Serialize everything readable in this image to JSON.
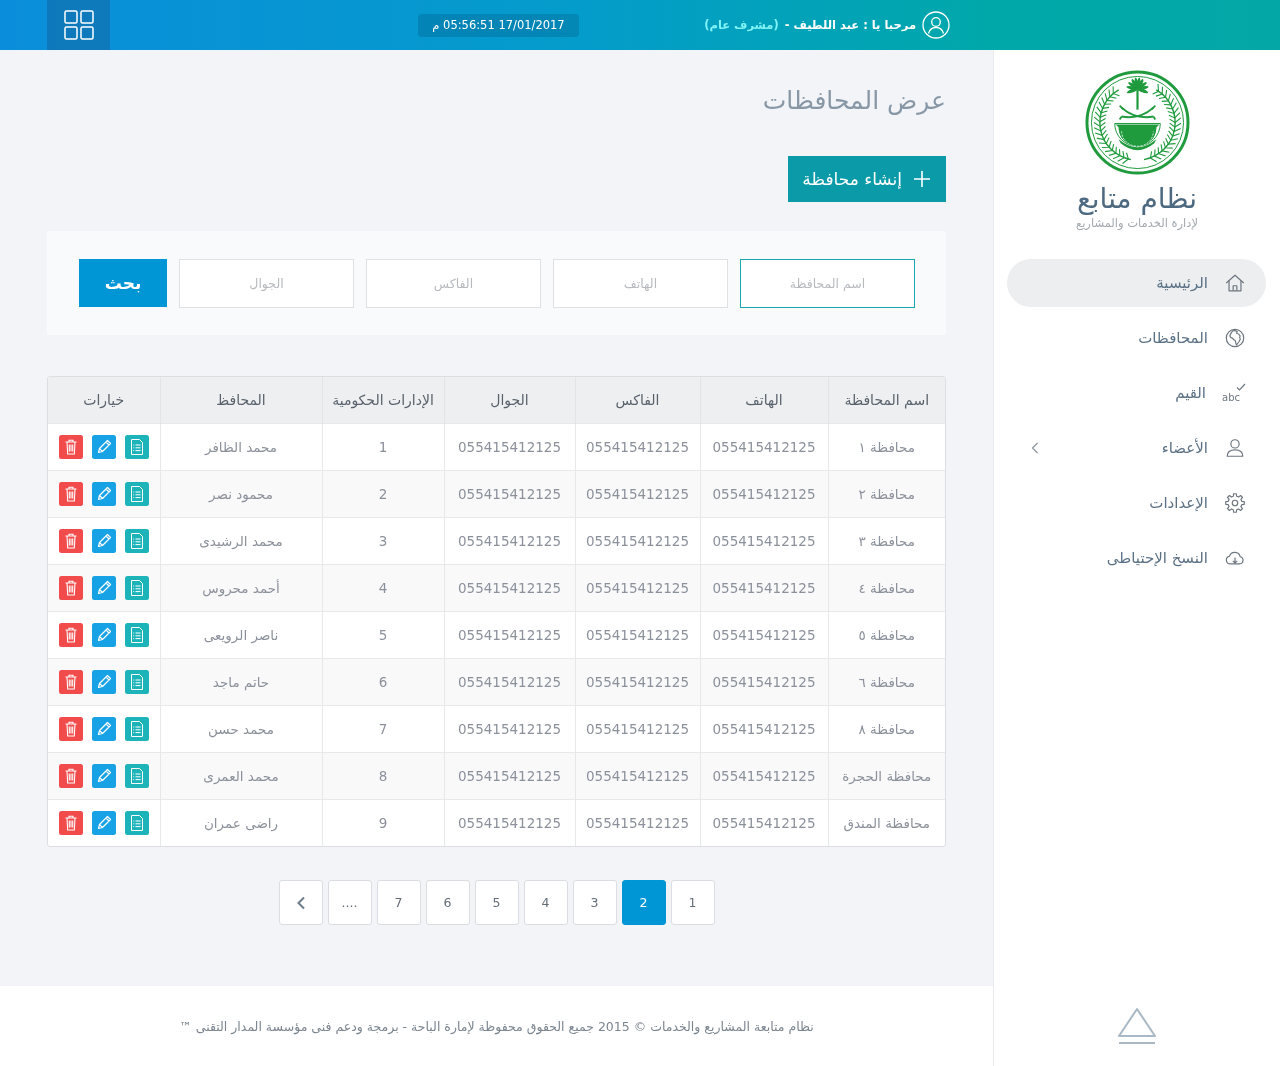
{
  "header": {
    "greeting": "مرحبا يا : عبد اللطيف -",
    "role": "(مشرف عام)",
    "datetime": "17/01/2017 05:56:51 م"
  },
  "sidebar": {
    "title": "نظام متابع",
    "subtitle": "لإدارة الخدمات والمشاريع",
    "items": [
      {
        "label": "الرئيسية",
        "kind": "link",
        "selected": true
      },
      {
        "label": "المحافظات",
        "kind": "link",
        "selected": false
      },
      {
        "label": "القيم",
        "kind": "link",
        "selected": false,
        "icon_text": "abc"
      },
      {
        "label": "الأعضاء",
        "kind": "group",
        "selected": false,
        "expanded": false
      },
      {
        "label": "الإعدادات",
        "kind": "link",
        "selected": false
      },
      {
        "label": "النسخ الإحتياطى",
        "kind": "link",
        "selected": false
      }
    ]
  },
  "page": {
    "title": "عرض المحافظات",
    "create_button": "إنشاء محافظة"
  },
  "search": {
    "fields": [
      {
        "placeholder": "اسم المحافظة",
        "focused": true
      },
      {
        "placeholder": "الهاتف",
        "focused": false
      },
      {
        "placeholder": "الفاكس",
        "focused": false
      },
      {
        "placeholder": "الجوال",
        "focused": false
      }
    ],
    "button": "بحث"
  },
  "table": {
    "columns": [
      "اسم المحافظة",
      "الهاتف",
      "الفاكس",
      "الجوال",
      "الإدارات الحكومية",
      "المحافظ",
      "خيارات"
    ],
    "rows": [
      {
        "cells": [
          "محافظة ١",
          "055415412125",
          "055415412125",
          "055415412125",
          "1",
          "محمد الظافر"
        ]
      },
      {
        "cells": [
          "محافظة ٢",
          "055415412125",
          "055415412125",
          "055415412125",
          "2",
          "محمود نصر"
        ]
      },
      {
        "cells": [
          "محافظة ٣",
          "055415412125",
          "055415412125",
          "055415412125",
          "3",
          "محمد الرشيدى"
        ]
      },
      {
        "cells": [
          "محافظة ٤",
          "055415412125",
          "055415412125",
          "055415412125",
          "4",
          "أحمد محروس"
        ]
      },
      {
        "cells": [
          "محافظة ٥",
          "055415412125",
          "055415412125",
          "055415412125",
          "5",
          "ناصر الرويعى"
        ]
      },
      {
        "cells": [
          "محافظة ٦",
          "055415412125",
          "055415412125",
          "055415412125",
          "6",
          "حاتم ماجد"
        ]
      },
      {
        "cells": [
          "محافظة ٨",
          "055415412125",
          "055415412125",
          "055415412125",
          "7",
          "محمد حسن"
        ]
      },
      {
        "cells": [
          "محافظة الحجرة",
          "055415412125",
          "055415412125",
          "055415412125",
          "8",
          "محمد العمرى"
        ]
      },
      {
        "cells": [
          "محافظة المندق",
          "055415412125",
          "055415412125",
          "055415412125",
          "9",
          "راضى عمران"
        ]
      }
    ]
  },
  "pagination": {
    "pages": [
      {
        "label": "1",
        "selected": false
      },
      {
        "label": "2",
        "selected": true
      },
      {
        "label": "3",
        "selected": false
      },
      {
        "label": "4",
        "selected": false
      },
      {
        "label": "5",
        "selected": false
      },
      {
        "label": "6",
        "selected": false
      },
      {
        "label": "7",
        "selected": false
      },
      {
        "label": "....",
        "selected": false
      }
    ]
  },
  "footer": {
    "text": "نظام متابعة المشاريع والخدمات © 2015 جميع الحقوق محفوظة لإمارة الباحة - برمجة ودعم فنى مؤسسة المدار التقنى ™"
  }
}
